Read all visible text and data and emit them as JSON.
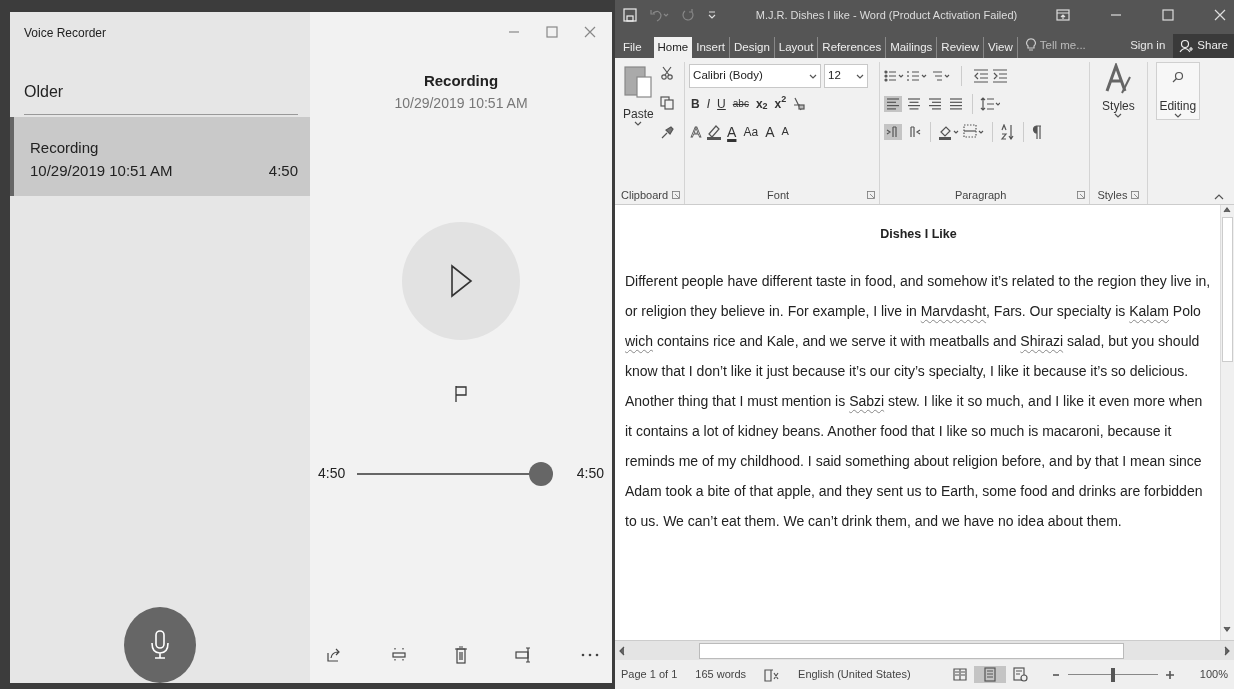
{
  "voice_recorder": {
    "title": "Voice Recorder",
    "section_header": "Older",
    "recordings": [
      {
        "name": "Recording",
        "date": "10/29/2019 10:51 AM",
        "duration": "4:50",
        "selected": true
      }
    ],
    "player": {
      "name": "Recording",
      "date": "10/29/2019 10:51 AM",
      "elapsed": "4:50",
      "total": "4:50",
      "level": 1
    }
  },
  "word": {
    "title": "M.J.R. Dishes I like - Word (Product Activation Failed)",
    "tabs": [
      {
        "label": "File",
        "selected": false
      },
      {
        "label": "Home",
        "selected": true
      },
      {
        "label": "Insert",
        "selected": false
      },
      {
        "label": "Design",
        "selected": false
      },
      {
        "label": "Layout",
        "selected": false
      },
      {
        "label": "References",
        "selected": false
      },
      {
        "label": "Mailings",
        "selected": false
      },
      {
        "label": "Review",
        "selected": false
      },
      {
        "label": "View",
        "selected": false
      }
    ],
    "tell_me": "Tell me...",
    "sign_in": "Sign in",
    "share": "Share",
    "ribbon": {
      "paste": "Paste",
      "font_name": "Calibri (Body)",
      "font_size": "12",
      "font_buttons": [
        {
          "kind": "bold",
          "label": "B"
        },
        {
          "kind": "italic",
          "label": "I"
        },
        {
          "kind": "underline",
          "label": "U"
        },
        {
          "kind": "strike",
          "label": "abc"
        },
        {
          "kind": "sub",
          "label": "x$_{2}$"
        },
        {
          "kind": "sup",
          "label": "x$^{2}$"
        }
      ],
      "font_row3": [
        {
          "kind": "effects",
          "label": "A"
        },
        {
          "kind": "color",
          "label": "A"
        },
        {
          "kind": "case",
          "label": "Aa"
        },
        {
          "kind": "grow",
          "label": "A"
        },
        {
          "kind": "shrink",
          "label": "A"
        }
      ],
      "align_buttons": [
        {
          "kind": "left",
          "selected": true
        },
        {
          "kind": "center",
          "selected": false
        },
        {
          "kind": "right",
          "selected": false
        },
        {
          "kind": "justify",
          "selected": false
        }
      ],
      "direction_buttons": [
        {
          "kind": "ltr",
          "selected": true
        },
        {
          "kind": "rtl",
          "selected": false
        }
      ],
      "styles": "Styles",
      "editing": "Editing",
      "groups": [
        "Clipboard",
        "Font",
        "Paragraph",
        "Styles"
      ]
    },
    "document": {
      "heading": "Dishes I Like",
      "paragraph": [
        {
          "text": "Different people have different taste in food, and somehow it’s related to the region they live in, or religion they believe in. For example, I live in ",
          "misspelled": false
        },
        {
          "text": "Marvdasht",
          "misspelled": true
        },
        {
          "text": ", Fars. Our specialty is ",
          "misspelled": false
        },
        {
          "text": "Kalam",
          "misspelled": true
        },
        {
          "text": " Polo ",
          "misspelled": false
        },
        {
          "text": "wich",
          "misspelled": true
        },
        {
          "text": " contains rice and Kale, and we serve it with meatballs and ",
          "misspelled": false
        },
        {
          "text": "Shirazi",
          "misspelled": true
        },
        {
          "text": " salad, but you should know that I don’t like it just because it’s our city’s specialty, I like it because it’s so delicious. Another thing that I must mention is ",
          "misspelled": false
        },
        {
          "text": "Sabzi",
          "misspelled": true
        },
        {
          "text": " stew. I like it so much, and I like it even more when it contains a lot of kidney beans. Another food that I like so much is macaroni, because it reminds me of my childhood. I said something about religion before, and by that I mean since Adam took a bite of that apple, and they sent us to Earth, some food and drinks are forbidden to us. We can’t eat them. We can’t drink them, and we have no idea about them.",
          "misspelled": false
        }
      ]
    },
    "status_bar": {
      "page": "Page 1 of 1",
      "words": "165 words",
      "language": "English (United States)",
      "zoom": "100%",
      "zoom_slider": {
        "level": 0.5
      },
      "views": [
        {
          "kind": "read",
          "selected": false
        },
        {
          "kind": "print",
          "selected": true
        },
        {
          "kind": "web",
          "selected": false
        }
      ]
    }
  }
}
